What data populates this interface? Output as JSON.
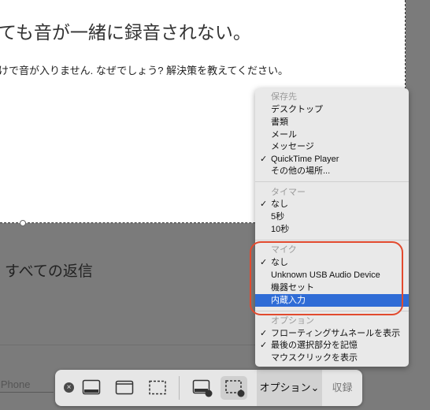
{
  "document": {
    "title": "ても音が一緒に録音されない。",
    "body": "けで音が入りません. なぜでしょう? 解決策を教えてください。",
    "replies_heading": "すべての返信",
    "iphone_label": "iPhone"
  },
  "menu": {
    "save_header": "保存先",
    "save_items": [
      {
        "label": "デスクトップ",
        "check": ""
      },
      {
        "label": "書類",
        "check": ""
      },
      {
        "label": "メール",
        "check": ""
      },
      {
        "label": "メッセージ",
        "check": ""
      },
      {
        "label": "QuickTime Player",
        "check": "✓"
      },
      {
        "label": "その他の場所...",
        "check": ""
      }
    ],
    "timer_header": "タイマー",
    "timer_items": [
      {
        "label": "なし",
        "check": "✓"
      },
      {
        "label": "5秒",
        "check": ""
      },
      {
        "label": "10秒",
        "check": ""
      }
    ],
    "mic_header": "マイク",
    "mic_items": [
      {
        "label": "なし",
        "check": "✓"
      },
      {
        "label": "Unknown USB Audio Device",
        "check": ""
      },
      {
        "label": "機器セット",
        "check": ""
      },
      {
        "label": "内蔵入力",
        "check": ""
      }
    ],
    "options_header": "オプション",
    "options_items": [
      {
        "label": "フローティングサムネールを表示",
        "check": "✓"
      },
      {
        "label": "最後の選択部分を記憶",
        "check": "✓"
      },
      {
        "label": "マウスクリックを表示",
        "check": ""
      }
    ]
  },
  "toolbar": {
    "close_icon": "×",
    "options_label": "オプション⌄",
    "capture_label": "収録"
  },
  "colors": {
    "highlight": "#2f6cd6",
    "annotation_ring": "#e24a2e"
  }
}
